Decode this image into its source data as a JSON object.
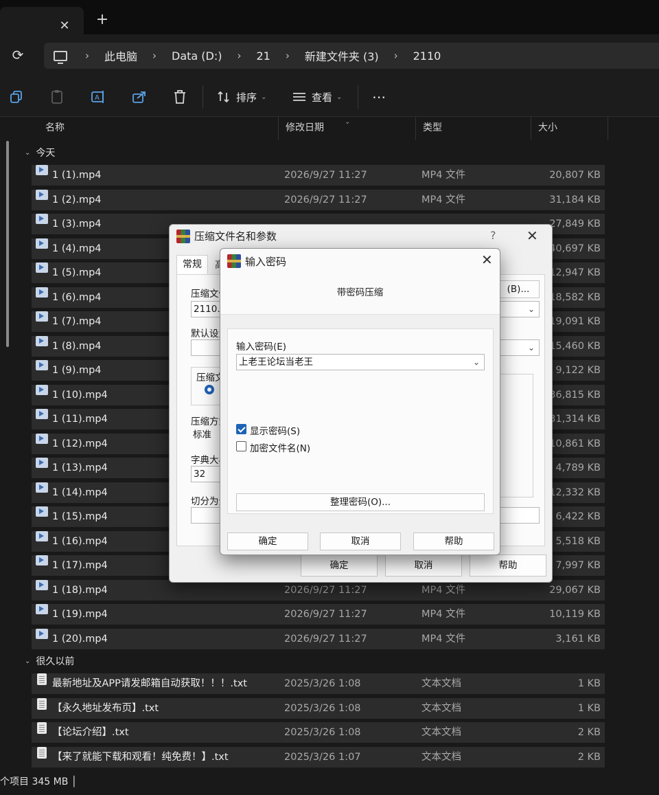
{
  "tab": {
    "close_glyph": "✕",
    "add_glyph": "+"
  },
  "address": {
    "refresh_glyph": "⟳",
    "separator": "›",
    "crumbs": [
      "此电脑",
      "Data (D:)",
      "21",
      "新建文件夹 (3)",
      "2110"
    ]
  },
  "toolbar": {
    "sort_label": "排序",
    "view_label": "查看",
    "more_glyph": "⋯",
    "chevron": "⌄"
  },
  "columns": {
    "name": "名称",
    "date": "修改日期",
    "type": "类型",
    "size": "大小"
  },
  "groups": {
    "today": "今天",
    "long_ago": "很久以前",
    "chevron": "⌄"
  },
  "video_files": [
    {
      "name": "1 (1).mp4",
      "date": "2026/9/27 11:27",
      "type": "MP4 文件",
      "size": "20,807 KB"
    },
    {
      "name": "1 (2).mp4",
      "date": "2026/9/27 11:27",
      "type": "MP4 文件",
      "size": "31,184 KB"
    },
    {
      "name": "1 (3).mp4",
      "date": "",
      "type": "",
      "size": "27,849 KB"
    },
    {
      "name": "1 (4).mp4",
      "date": "",
      "type": "",
      "size": "40,697 KB"
    },
    {
      "name": "1 (5).mp4",
      "date": "",
      "type": "",
      "size": "12,947 KB"
    },
    {
      "name": "1 (6).mp4",
      "date": "",
      "type": "",
      "size": "18,582 KB"
    },
    {
      "name": "1 (7).mp4",
      "date": "",
      "type": "",
      "size": "19,091 KB"
    },
    {
      "name": "1 (8).mp4",
      "date": "",
      "type": "",
      "size": "15,460 KB"
    },
    {
      "name": "1 (9).mp4",
      "date": "",
      "type": "",
      "size": "9,122 KB"
    },
    {
      "name": "1 (10).mp4",
      "date": "",
      "type": "",
      "size": "36,815 KB"
    },
    {
      "name": "1 (11).mp4",
      "date": "",
      "type": "",
      "size": "31,314 KB"
    },
    {
      "name": "1 (12).mp4",
      "date": "",
      "type": "",
      "size": "10,861 KB"
    },
    {
      "name": "1 (13).mp4",
      "date": "",
      "type": "",
      "size": "4,789 KB"
    },
    {
      "name": "1 (14).mp4",
      "date": "",
      "type": "",
      "size": "12,332 KB"
    },
    {
      "name": "1 (15).mp4",
      "date": "",
      "type": "",
      "size": "6,422 KB"
    },
    {
      "name": "1 (16).mp4",
      "date": "",
      "type": "",
      "size": "5,518 KB"
    },
    {
      "name": "1 (17).mp4",
      "date": "",
      "type": "",
      "size": "7,997 KB"
    },
    {
      "name": "1 (18).mp4",
      "date": "2026/9/27 11:27",
      "type": "MP4 文件",
      "size": "29,067 KB"
    },
    {
      "name": "1 (19).mp4",
      "date": "2026/9/27 11:27",
      "type": "MP4 文件",
      "size": "10,119 KB"
    },
    {
      "name": "1 (20).mp4",
      "date": "2026/9/27 11:27",
      "type": "MP4 文件",
      "size": "3,161 KB"
    }
  ],
  "text_files": [
    {
      "name": "最新地址及APP请发邮箱自动获取！！！.txt",
      "date": "2025/3/26 1:08",
      "type": "文本文档",
      "size": "1 KB"
    },
    {
      "name": "【永久地址发布页】.txt",
      "date": "2025/3/26 1:08",
      "type": "文本文档",
      "size": "1 KB"
    },
    {
      "name": "【论坛介绍】.txt",
      "date": "2025/3/26 1:08",
      "type": "文本文档",
      "size": "2 KB"
    },
    {
      "name": "【来了就能下载和观看！纯免费！】.txt",
      "date": "2025/3/26 1:07",
      "type": "文本文档",
      "size": "2 KB"
    }
  ],
  "status": {
    "text": "个项目  345 MB  │"
  },
  "archive_dialog": {
    "title": "压缩文件名和参数",
    "help_glyph": "?",
    "close_glyph": "✕",
    "tab_general": "常规",
    "tab_advanced": "高",
    "archive_name_label": "压缩文件",
    "archive_name_value": "2110.r",
    "browse_label": "(B)...",
    "default_profile_label": "默认设置",
    "format_group_label": "压缩文",
    "method_label": "压缩方式",
    "method_value": "标准",
    "dict_label": "字典大小",
    "dict_value": "32",
    "split_label": "切分为分卷",
    "ok_label": "确定",
    "cancel_label": "取消",
    "help_label": "帮助"
  },
  "password_dialog": {
    "title": "输入密码",
    "close_glyph": "✕",
    "subtitle": "带密码压缩",
    "password_label": "输入密码(E)",
    "password_value": "上老王论坛当老王",
    "show_password_label": "显示密码(S)",
    "show_password_checked": true,
    "encrypt_names_label": "加密文件名(N)",
    "encrypt_names_checked": false,
    "organize_label": "整理密码(O)...",
    "ok_label": "确定",
    "cancel_label": "取消",
    "help_label": "帮助"
  }
}
